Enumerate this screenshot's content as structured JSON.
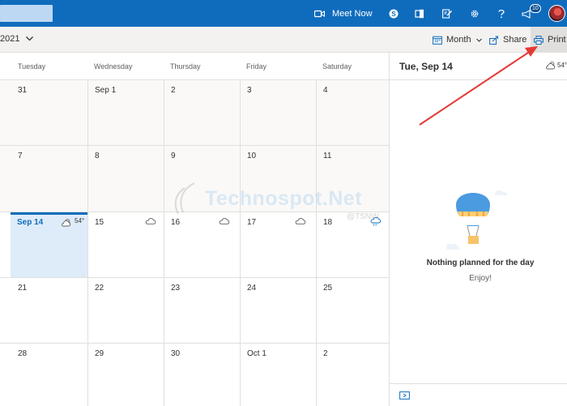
{
  "topbar": {
    "meet_now_label": "Meet Now",
    "notification_count": "10",
    "icons": [
      "search-box",
      "video-icon",
      "skype-icon",
      "office-icon",
      "edit-icon",
      "gear-icon",
      "help-icon",
      "megaphone-icon",
      "avatar"
    ],
    "accent_color": "#0f6cbd"
  },
  "toolbar": {
    "year_partial": "2021",
    "view_label": "Month",
    "share_label": "Share",
    "print_label": "Print"
  },
  "calendar": {
    "day_headers": [
      "Tuesday",
      "Wednesday",
      "Thursday",
      "Friday",
      "Saturday"
    ],
    "weeks": [
      {
        "days": [
          {
            "num": "31"
          },
          {
            "num": "Sep 1"
          },
          {
            "num": "2"
          },
          {
            "num": "3"
          },
          {
            "num": "4"
          }
        ]
      },
      {
        "days": [
          {
            "num": "7"
          },
          {
            "num": "8"
          },
          {
            "num": "9"
          },
          {
            "num": "10"
          },
          {
            "num": "11"
          }
        ]
      },
      {
        "days": [
          {
            "num": "Sep 14",
            "temp": "54°",
            "today": true
          },
          {
            "num": "15"
          },
          {
            "num": "16"
          },
          {
            "num": "17"
          },
          {
            "num": "18"
          }
        ]
      },
      {
        "days": [
          {
            "num": "21"
          },
          {
            "num": "22"
          },
          {
            "num": "23"
          },
          {
            "num": "24"
          },
          {
            "num": "25"
          }
        ]
      },
      {
        "days": [
          {
            "num": "28"
          },
          {
            "num": "29"
          },
          {
            "num": "30"
          },
          {
            "num": "Oct 1"
          },
          {
            "num": "2"
          }
        ]
      }
    ]
  },
  "pane": {
    "date": "Tue, Sep 14",
    "temp": "54°",
    "empty_title": "Nothing planned for the day",
    "empty_sub": "Enjoy!"
  },
  "watermark": {
    "text": "Technospot.Net",
    "handle": "@TSNW"
  }
}
